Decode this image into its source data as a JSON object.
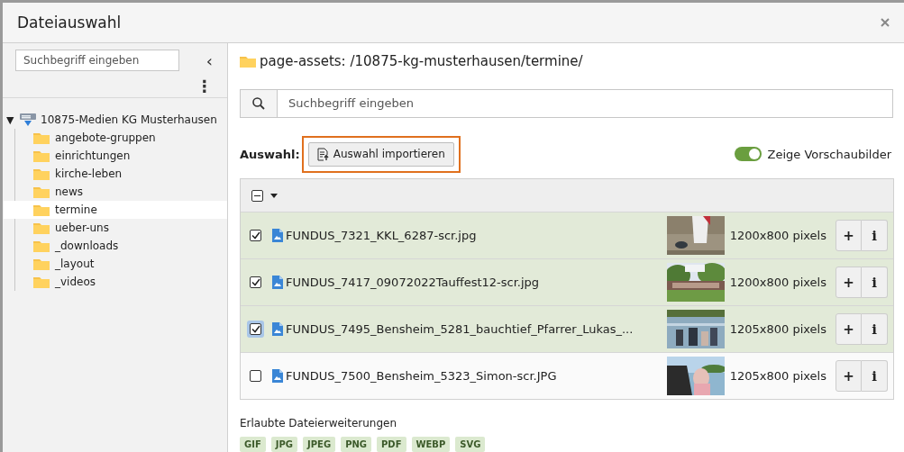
{
  "dialog": {
    "title": "Dateiauswahl"
  },
  "sidebar": {
    "search": {
      "placeholder": "Suchbegriff eingeben"
    },
    "collapse_icon": "‹",
    "menu_icon": "⋮",
    "tree": {
      "toggle_icon": "▼",
      "label": "10875-Medien KG Musterhausen",
      "expanded": true,
      "children": [
        {
          "label": "angebote-gruppen",
          "selected": false
        },
        {
          "label": "einrichtungen",
          "selected": false
        },
        {
          "label": "kirche-leben",
          "selected": false
        },
        {
          "label": "news",
          "selected": false
        },
        {
          "label": "termine",
          "selected": true
        },
        {
          "label": "ueber-uns",
          "selected": false
        },
        {
          "label": "_downloads",
          "selected": false
        },
        {
          "label": "_layout",
          "selected": false
        },
        {
          "label": "_videos",
          "selected": false
        }
      ]
    }
  },
  "main": {
    "path": "page-assets: /10875-kg-musterhausen/termine/",
    "search": {
      "placeholder": "Suchbegriff eingeben"
    },
    "selection_label": "Auswahl:",
    "import_button": {
      "label": "Auswahl importieren",
      "highlighted": true
    },
    "thumbnail_toggle": {
      "label": "Zeige Vorschaubilder",
      "on": true
    },
    "bulk_checkbox": {
      "indeterminate": true
    },
    "files": [
      {
        "name": "FUNDUS_7321_KKL_6287-scr.jpg",
        "checked": true,
        "focused": false,
        "kind": "picture",
        "dimensions": "1200x800 pixels",
        "actions": [
          "+",
          "i"
        ]
      },
      {
        "name": "FUNDUS_7417_09072022Tauffest12-scr.jpg",
        "checked": true,
        "focused": false,
        "kind": "picture",
        "dimensions": "1200x800 pixels",
        "actions": [
          "+",
          "i"
        ]
      },
      {
        "name": "FUNDUS_7495_Bensheim_5281_bauchtief_Pfarrer_Lukas_...",
        "checked": true,
        "focused": true,
        "kind": "picture",
        "dimensions": "1205x800 pixels",
        "actions": [
          "+",
          "i"
        ]
      },
      {
        "name": "FUNDUS_7500_Bensheim_5323_Simon-scr.JPG",
        "checked": false,
        "focused": false,
        "kind": "picture",
        "dimensions": "1205x800 pixels",
        "actions": [
          "+",
          "i"
        ]
      }
    ],
    "extensions_label": "Erlaubte Dateierweiterungen",
    "extensions": [
      "GIF",
      "JPG",
      "JPEG",
      "PNG",
      "PDF",
      "WEBP",
      "SVG"
    ]
  }
}
